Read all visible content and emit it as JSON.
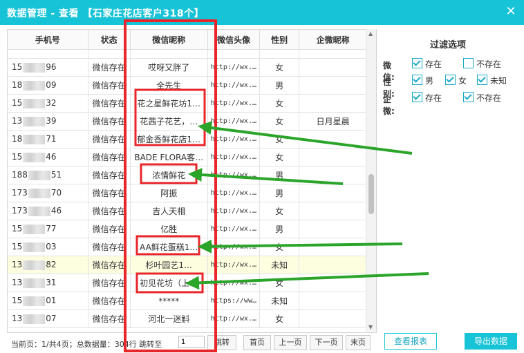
{
  "window": {
    "title": "数据管理 - 查看 【石家庄花店客户318个】",
    "close_glyph": "✕"
  },
  "table": {
    "columns": [
      "手机号",
      "状态",
      "微信昵称",
      "微信头像",
      "性别",
      "企微昵称"
    ],
    "rows": [
      {
        "phone_start": "15",
        "phone_end": "96",
        "status": "微信存在",
        "nickname": "哎呀又胖了",
        "avatar": "http://wx.…",
        "gender": "女",
        "wecom": ""
      },
      {
        "phone_start": "18",
        "phone_end": "09",
        "status": "微信存在",
        "nickname": "全先生",
        "avatar": "http://wx.…",
        "gender": "男",
        "wecom": ""
      },
      {
        "phone_start": "15",
        "phone_end": "32",
        "status": "微信存在",
        "nickname": "花之星鲜花坊1…",
        "avatar": "http://wx.…",
        "gender": "女",
        "wecom": ""
      },
      {
        "phone_start": "13",
        "phone_end": "39",
        "status": "微信存在",
        "nickname": "花茜子花艺，…",
        "avatar": "http://wx.…",
        "gender": "女",
        "wecom": "日月星晨"
      },
      {
        "phone_start": "18",
        "phone_end": "71",
        "status": "微信存在",
        "nickname": "郁金香鲜花店1…",
        "avatar": "http://wx.…",
        "gender": "女",
        "wecom": ""
      },
      {
        "phone_start": "15",
        "phone_end": "46",
        "status": "微信存在",
        "nickname": "BADE FLORA客…",
        "avatar": "http://wx.…",
        "gender": "女",
        "wecom": ""
      },
      {
        "phone_start": "188",
        "phone_end": "51",
        "status": "微信存在",
        "nickname": "浓情鲜花",
        "avatar": "http://wx.…",
        "gender": "男",
        "wecom": ""
      },
      {
        "phone_start": "173",
        "phone_end": "70",
        "status": "微信存在",
        "nickname": "阿振",
        "avatar": "http://wx.…",
        "gender": "男",
        "wecom": ""
      },
      {
        "phone_start": "173",
        "phone_end": "46",
        "status": "微信存在",
        "nickname": "吉人天相",
        "avatar": "http://wx.…",
        "gender": "女",
        "wecom": ""
      },
      {
        "phone_start": "15",
        "phone_end": "77",
        "status": "微信存在",
        "nickname": "亿胜",
        "avatar": "http://wx.…",
        "gender": "男",
        "wecom": ""
      },
      {
        "phone_start": "15",
        "phone_end": "03",
        "status": "微信存在",
        "nickname": "AA鲜花蛋糕1…",
        "avatar": "http://wx.…",
        "gender": "女",
        "wecom": ""
      },
      {
        "phone_start": "13",
        "phone_end": "82",
        "status": "微信存在",
        "nickname": "杉叶园艺1…",
        "avatar": "http://wx.…",
        "gender": "未知",
        "wecom": ""
      },
      {
        "phone_start": "13",
        "phone_end": "31",
        "status": "微信存在",
        "nickname": "初见花坊（上…",
        "avatar": "http://wx.…",
        "gender": "女",
        "wecom": ""
      },
      {
        "phone_start": "15",
        "phone_end": "01",
        "status": "微信存在",
        "nickname": "*****",
        "avatar": "https://ww…",
        "gender": "未知",
        "wecom": ""
      },
      {
        "phone_start": "13",
        "phone_end": "07",
        "status": "微信存在",
        "nickname": "河北一迷斛",
        "avatar": "http://wx.…",
        "gender": "女",
        "wecom": ""
      }
    ]
  },
  "pager": {
    "info": "当前页：1/共4页；总数据量：304行",
    "jump_label": "跳转至",
    "page_value": "1",
    "go_label": "跳转",
    "first_label": "首页",
    "prev_label": "上一页",
    "next_label": "下一页",
    "last_label": "末页"
  },
  "filter": {
    "title": "过滤选项",
    "wechat_label": "微信:",
    "wechat_exist": "存在",
    "wechat_not_exist": "不存在",
    "gender_label": "性别:",
    "gender_male": "男",
    "gender_female": "女",
    "gender_unknown": "未知",
    "wecom_label": "企微:",
    "wecom_exist": "存在",
    "wecom_not_exist": "不存在"
  },
  "buttons": {
    "report_label": "查看报表",
    "export_label": "导出数据"
  },
  "colors": {
    "accent": "#17c3d6",
    "annotation_red": "#e8262a",
    "annotation_green": "#2aa52a"
  }
}
